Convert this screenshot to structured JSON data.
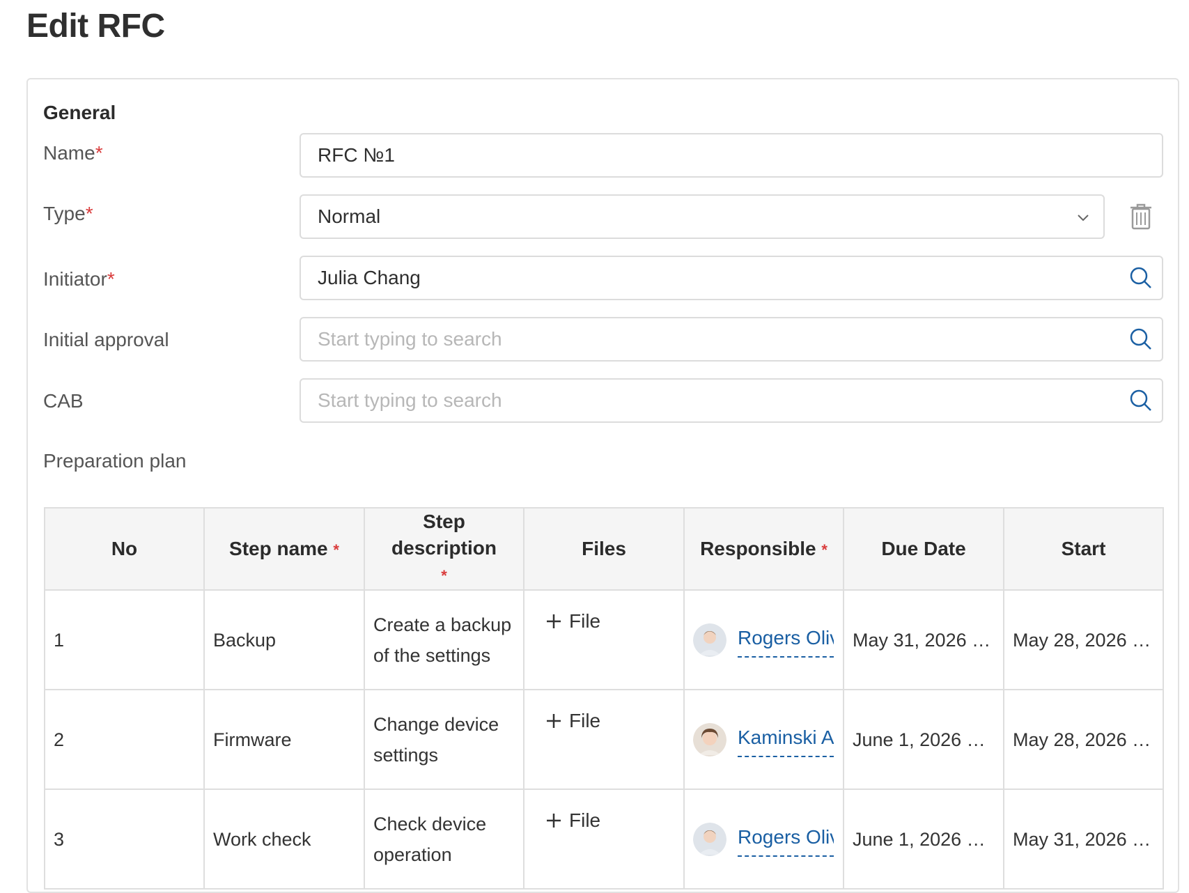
{
  "page": {
    "title": "Edit RFC"
  },
  "general": {
    "section_title": "General",
    "name": {
      "label": "Name",
      "required": "*",
      "value": "RFC №1"
    },
    "type": {
      "label": "Type",
      "required": "*",
      "value": "Normal"
    },
    "initiator": {
      "label": "Initiator",
      "required": "*",
      "value": "Julia Chang"
    },
    "initial_approval": {
      "label": "Initial approval",
      "placeholder": "Start typing to search"
    },
    "cab": {
      "label": "CAB",
      "placeholder": "Start typing to search"
    },
    "preparation_plan_label": "Preparation plan"
  },
  "plan": {
    "headers": {
      "no": "No",
      "step_name": "Step name",
      "step_description": "Step description",
      "files": "Files",
      "responsible": "Responsible",
      "due_date": "Due Date",
      "start": "Start",
      "required": "*"
    },
    "add_file_label": "File",
    "rows": [
      {
        "no": "1",
        "step_name": "Backup",
        "description": "Create a backup of the settings",
        "responsible": "Rogers Oliv",
        "due_date": "May 31, 2026 1...",
        "start": "May 28, 2026 1..."
      },
      {
        "no": "2",
        "step_name": "Firmware",
        "description": "Change device settings",
        "responsible": "Kaminski A",
        "due_date": "June 1, 2026 12...",
        "start": "May 28, 2026 1..."
      },
      {
        "no": "3",
        "step_name": "Work check",
        "description": "Check device operation",
        "responsible": "Rogers Oliv",
        "due_date": "June 1, 2026 12...",
        "start": "May 31, 2026 1..."
      }
    ]
  },
  "colors": {
    "accent": "#1a5fa3",
    "required": "#d93b3b",
    "border": "#dcdcdc"
  }
}
